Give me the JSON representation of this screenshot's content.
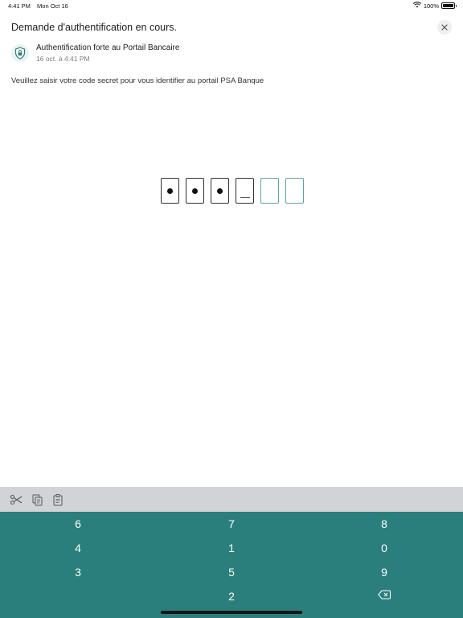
{
  "status_bar": {
    "time": "4:41 PM",
    "date": "Mon Oct 16",
    "battery": "100%",
    "battery_level": 1.0
  },
  "header": {
    "title": "Demande d'authentification en cours."
  },
  "notification": {
    "icon": "shield-lock-icon",
    "title": "Authentification forte au Portail Bancaire",
    "time": "16 oct. à 4:41 PM"
  },
  "instruction": "Veuillez saisir votre code secret pour vous identifier au portail PSA Banque",
  "pin": {
    "length": 6,
    "filled": 3,
    "active_index": 3
  },
  "toolbar": {
    "icons": [
      "scissors-icon",
      "copy-icon",
      "paste-icon"
    ]
  },
  "keypad": {
    "keys": [
      "6",
      "7",
      "8",
      "4",
      "1",
      "0",
      "3",
      "5",
      "9",
      "2"
    ],
    "delete_icon": "backspace-icon"
  },
  "colors": {
    "keypad_bg": "#2a7f7d",
    "accent": "#5fa3a3",
    "toolbar_bg": "#d1d3d7"
  }
}
